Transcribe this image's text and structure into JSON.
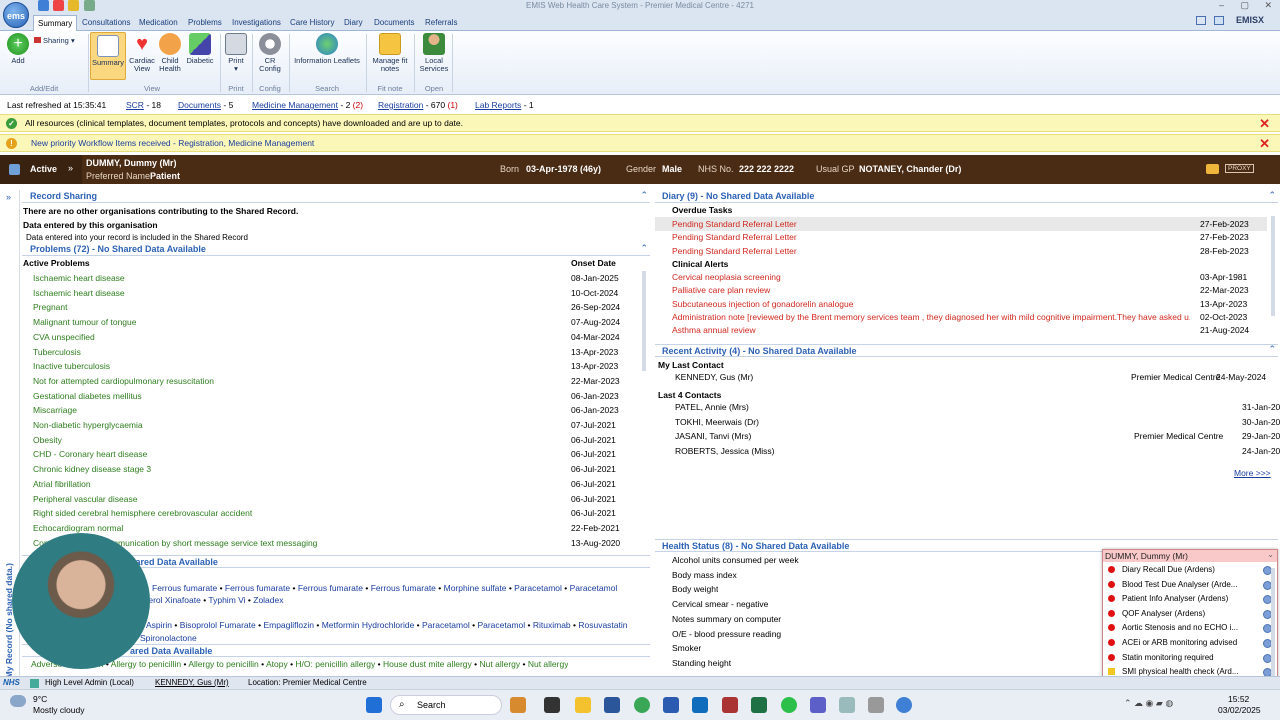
{
  "window": {
    "title": "EMIS Web Health Care System - Premier Medical Centre - 4271",
    "brand": "EMISX"
  },
  "tabs": [
    "Summary",
    "Consultations",
    "Medication",
    "Problems",
    "Investigations",
    "Care History",
    "Diary",
    "Documents",
    "Referrals"
  ],
  "ribbon": {
    "add": "Add",
    "sharing": "Sharing",
    "summary": "Summary",
    "cardiac": "Cardiac View",
    "child": "Child Health",
    "diabetic": "Diabetic",
    "print": "Print",
    "cr_config": "CR Config",
    "info_leaflets": "Information Leaflets",
    "fit_notes": "Manage fit notes",
    "local_services": "Local Services",
    "groups": {
      "add_edit": "Add/Edit",
      "view": "View",
      "print": "Print",
      "config": "Config",
      "search": "Search",
      "fit_note": "Fit note",
      "open": "Open"
    }
  },
  "status": {
    "refreshed": "Last refreshed at  15:35:41",
    "scr": "SCR",
    "scr_n": "- 18",
    "documents": "Documents",
    "documents_n": "- 5",
    "medicine": "Medicine Management",
    "medicine_n": "- 2",
    "medicine_red": "(2)",
    "registration": "Registration",
    "registration_n": "- 670",
    "registration_red": "(1)",
    "lab": "Lab Reports",
    "lab_n": "- 1"
  },
  "banners": {
    "resources": "All resources (clinical templates, document templates, protocols and concepts) have downloaded and are up to date.",
    "workflow": "New priority Workflow Items received - Registration, Medicine Management"
  },
  "patient": {
    "state": "Active",
    "name": "DUMMY, Dummy (Mr)",
    "preferred_label": "Preferred Name",
    "preferred": "Patient",
    "born_label": "Born",
    "born": "03-Apr-1978 (46y)",
    "gender_label": "Gender",
    "gender": "Male",
    "nhs_label": "NHS No.",
    "nhs": "222 222 2222",
    "gp_label": "Usual GP",
    "gp": "NOTANEY, Chander (Dr)",
    "proxy": "PROXY"
  },
  "sidebar_label": "View -> My Record (No shared data.)",
  "record_sharing": {
    "title": "Record Sharing",
    "line1": "There are no other organisations contributing to the Shared Record.",
    "line2": "Data entered by this organisation",
    "line3": "Data entered into your record is included in the Shared Record"
  },
  "problems": {
    "title": "Problems (72) - No Shared Data Available",
    "col1": "Active Problems",
    "col2": "Onset Date",
    "rows": [
      [
        "Ischaemic heart disease",
        "08-Jan-2025"
      ],
      [
        "Ischaemic heart disease",
        "10-Oct-2024"
      ],
      [
        "Pregnant",
        "26-Sep-2024"
      ],
      [
        "Malignant tumour of tongue",
        "07-Aug-2024"
      ],
      [
        "CVA unspecified",
        "04-Mar-2024"
      ],
      [
        "Tuberculosis",
        "13-Apr-2023"
      ],
      [
        "Inactive tuberculosis",
        "13-Apr-2023"
      ],
      [
        "Not for attempted cardiopulmonary resuscitation",
        "22-Mar-2023"
      ],
      [
        "Gestational diabetes mellitus",
        "06-Jan-2023"
      ],
      [
        "Miscarriage",
        "06-Jan-2023"
      ],
      [
        "Non-diabetic hyperglycaemia",
        "07-Jul-2021"
      ],
      [
        "Obesity",
        "06-Jul-2021"
      ],
      [
        "CHD - Coronary heart disease",
        "06-Jul-2021"
      ],
      [
        "Chronic kidney disease stage 3",
        "06-Jul-2021"
      ],
      [
        "Atrial fibrillation",
        "06-Jul-2021"
      ],
      [
        "Peripheral vascular disease",
        "06-Jul-2021"
      ],
      [
        "Right sided cerebral hemisphere cerebrovascular accident",
        "06-Jul-2021"
      ],
      [
        "Echocardiogram normal",
        "22-Feb-2021"
      ],
      [
        "Consent given for communication by short message service text messaging",
        "13-Aug-2020"
      ]
    ]
  },
  "medication": {
    "title": "hared Data Available",
    "line1": [
      "Ferrous fumarate",
      "Ferrous fumarate",
      "Ferrous fumarate",
      "Ferrous fumarate",
      "Morphine sulfate",
      "Paracetamol",
      "Paracetamol"
    ],
    "line2": [
      "terol Xinafoate",
      "Typhim Vi",
      "Zoladex"
    ],
    "line3": [
      "Aspirin",
      "Bisoprolol Fumarate",
      "Empagliflozin",
      "Metformin Hydrochloride",
      "Paracetamol",
      "Paracetamol",
      "Rituximab",
      "Rosuvastatin"
    ],
    "line4": [
      "Spironolactone"
    ]
  },
  "allergies": {
    "title": "ared Data Available",
    "items": [
      "Adverse",
      "buprofen",
      "Allergy to penicillin",
      "Allergy to penicillin",
      "Atopy",
      "H/O: penicillin allergy",
      "House dust mite allergy",
      "Nut allergy",
      "Nut allergy"
    ]
  },
  "diary": {
    "title": "Diary (9) - No Shared Data Available",
    "overdue": "Overdue Tasks",
    "tasks": [
      [
        "Pending Standard Referral Letter",
        "27-Feb-2023"
      ],
      [
        "Pending Standard Referral Letter",
        "27-Feb-2023"
      ],
      [
        "Pending Standard Referral Letter",
        "28-Feb-2023"
      ]
    ],
    "alerts_title": "Clinical Alerts",
    "alerts": [
      [
        "Cervical neoplasia screening",
        "03-Apr-1981"
      ],
      [
        "Palliative care plan review",
        "22-Mar-2023"
      ],
      [
        "Subcutaneous injection of gonadorelin analogue",
        "13-Apr-2023"
      ],
      [
        "Administration note [reviewed by the Brent memory services team , they diagnosed her with mild cognitive impairment.They have asked u...",
        "02-Oct-2023"
      ],
      [
        "Asthma annual review",
        "21-Aug-2024"
      ]
    ]
  },
  "activity": {
    "title": "Recent Activity (4) - No Shared Data Available",
    "last_contact": "My Last Contact",
    "me": [
      "KENNEDY, Gus (Mr)",
      "Premier Medical Centre",
      "24-May-2024"
    ],
    "last4": "Last 4 Contacts",
    "contacts": [
      [
        "PATEL, Annie (Mrs)",
        "",
        "31-Jan-2025"
      ],
      [
        "TOKHI, Meerwais (Dr)",
        "",
        "30-Jan-2025"
      ],
      [
        "JASANI, Tanvi (Mrs)",
        "Premier Medical Centre",
        "29-Jan-2025"
      ],
      [
        "ROBERTS, Jessica (Miss)",
        "",
        "24-Jan-2025"
      ]
    ],
    "more": "More >>>"
  },
  "health": {
    "title": "Health Status (8) - No Shared Data Available",
    "items": [
      "Alcohol units consumed per week",
      "Body mass index",
      "Body weight",
      "Cervical smear - negative",
      "Notes summary on computer",
      "O/E - blood pressure reading",
      "Smoker",
      "Standing height"
    ]
  },
  "popup": {
    "title": "DUMMY, Dummy (Mr)",
    "items": [
      "Diary Recall Due (Ardens)",
      "Blood Test Due Analyser (Arde...",
      "Patient Info Analyser (Ardens)",
      "QOF Analyser (Ardens)",
      "Aortic Stenosis and no ECHO i...",
      "ACEi or ARB monitoring advised",
      "Statin monitoring required",
      "SMI physical health check (Ard..."
    ]
  },
  "footer": {
    "nhs": "NHS",
    "role": "High Level Admin (Local)",
    "user": "KENNEDY, Gus (Mr)",
    "location": "Location: Premier Medical Centre"
  },
  "taskbar": {
    "temp": "9°C",
    "weather": "Mostly cloudy",
    "search": "Search",
    "time": "15:52",
    "date": "03/02/2025"
  }
}
